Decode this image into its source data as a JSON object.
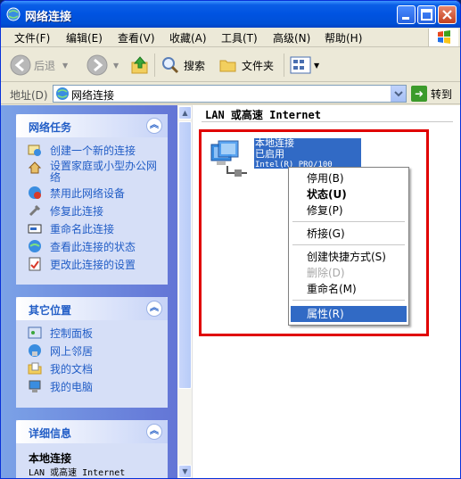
{
  "window": {
    "title": "网络连接"
  },
  "menu": [
    "文件(F)",
    "编辑(E)",
    "查看(V)",
    "收藏(A)",
    "工具(T)",
    "高级(N)",
    "帮助(H)"
  ],
  "toolbar": {
    "back": "后退",
    "search": "搜索",
    "folders": "文件夹"
  },
  "address": {
    "label": "地址(D)",
    "value": "网络连接",
    "go": "转到"
  },
  "tasks_panel": {
    "title": "网络任务",
    "items": [
      "创建一个新的连接",
      "设置家庭或小型办公网络",
      "禁用此网络设备",
      "修复此连接",
      "重命名此连接",
      "查看此连接的状态",
      "更改此连接的设置"
    ]
  },
  "other_panel": {
    "title": "其它位置",
    "items": [
      "控制面板",
      "网上邻居",
      "我的文档",
      "我的电脑"
    ]
  },
  "details_panel": {
    "title": "详细信息",
    "name": "本地连接",
    "type": "LAN 或高速 Internet"
  },
  "content": {
    "group_header": "LAN 或高速 Internet",
    "connection": {
      "name": "本地连接",
      "status": "已启用",
      "device": "Intel(R) PRO/100"
    }
  },
  "context_menu": {
    "items": [
      "停用(B)",
      "状态(U)",
      "修复(P)",
      "桥接(G)",
      "创建快捷方式(S)",
      "删除(D)",
      "重命名(M)",
      "属性(R)"
    ],
    "selected": "属性(R)",
    "disabled": "删除(D)",
    "default": "状态(U)"
  },
  "colors": {
    "title_bar": "#0053e1",
    "link": "#215dc6",
    "selection": "#316ac5",
    "highlight_border": "#e00000"
  }
}
